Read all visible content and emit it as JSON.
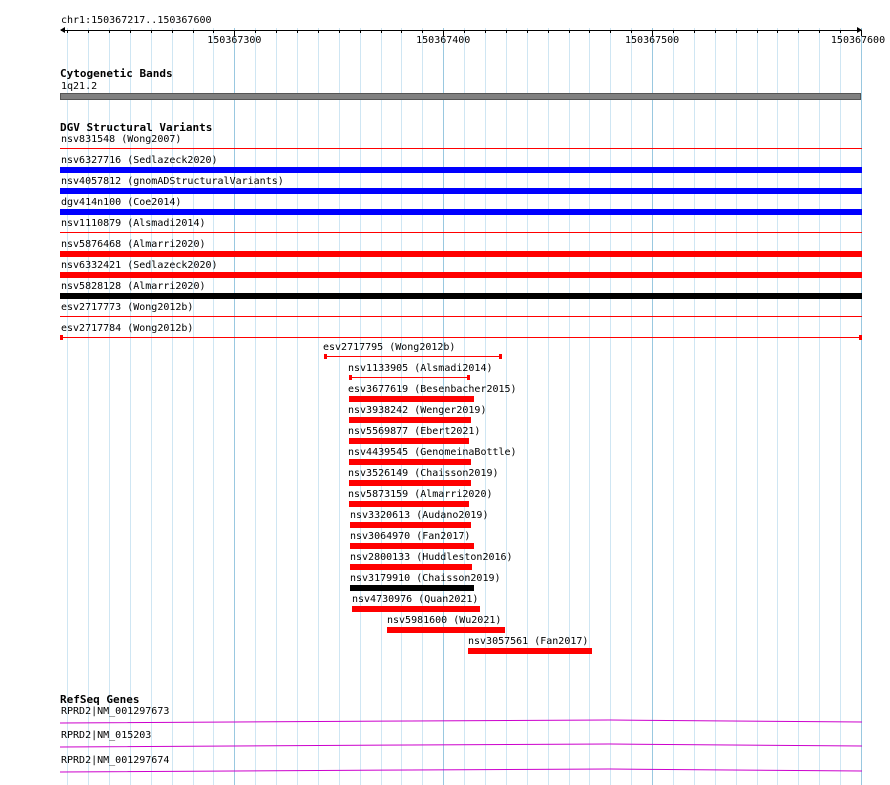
{
  "ruler": {
    "location": "chr1:150367217..150367600",
    "labels": [
      {
        "text": "150367300",
        "pos": 150367300
      },
      {
        "text": "150367400",
        "pos": 150367400
      },
      {
        "text": "150367500",
        "pos": 150367500
      },
      {
        "text": "150367600",
        "pos": 150367600
      }
    ]
  },
  "tracks": {
    "cytobands": {
      "title": "Cytogenetic Bands",
      "band": {
        "name": "1q21.2",
        "color": "#808080"
      }
    },
    "dgv": {
      "title": "DGV Structural Variants",
      "full_width_items": [
        {
          "label": "nsv831548 (Wong2007)",
          "color": "#ff0000",
          "style": "thin-line"
        },
        {
          "label": "nsv6327716 (Sedlazeck2020)",
          "color": "#0000ff",
          "style": "thick"
        },
        {
          "label": "nsv4057812 (gnomADStructuralVariants)",
          "color": "#0000ff",
          "style": "thick"
        },
        {
          "label": "dgv414n100 (Coe2014)",
          "color": "#0000ff",
          "style": "thick"
        },
        {
          "label": "nsv1110879 (Alsmadi2014)",
          "color": "#ff0000",
          "style": "thin-line"
        },
        {
          "label": "nsv5876468 (Almarri2020)",
          "color": "#ff0000",
          "style": "thick"
        },
        {
          "label": "nsv6332421 (Sedlazeck2020)",
          "color": "#ff0000",
          "style": "thick"
        },
        {
          "label": "nsv5828128 (Almarri2020)",
          "color": "#000000",
          "style": "thick"
        },
        {
          "label": "esv2717773 (Wong2012b)",
          "color": "#ff0000",
          "style": "thin-line"
        },
        {
          "label": "esv2717784 (Wong2012b)",
          "color": "#ff0000",
          "style": "thin-capped"
        }
      ],
      "partial_items": [
        {
          "label": "esv2717795 (Wong2012b)",
          "color": "#ff0000",
          "style": "thin-capped"
        },
        {
          "label": "nsv1133905 (Alsmadi2014)",
          "color": "#ff0000",
          "style": "thin-capped"
        },
        {
          "label": "esv3677619 (Besenbacher2015)",
          "color": "#ff0000",
          "style": "thick"
        },
        {
          "label": "nsv3938242 (Wenger2019)",
          "color": "#ff0000",
          "style": "thick"
        },
        {
          "label": "nsv5569877 (Ebert2021)",
          "color": "#ff0000",
          "style": "thick"
        },
        {
          "label": "nsv4439545 (GenomeinaBottle)",
          "color": "#ff0000",
          "style": "thick"
        },
        {
          "label": "nsv3526149 (Chaisson2019)",
          "color": "#ff0000",
          "style": "thick"
        },
        {
          "label": "nsv5873159 (Almarri2020)",
          "color": "#ff0000",
          "style": "thick"
        },
        {
          "label": "nsv3320613 (Audano2019)",
          "color": "#ff0000",
          "style": "thick"
        },
        {
          "label": "nsv3064970 (Fan2017)",
          "color": "#ff0000",
          "style": "thick"
        },
        {
          "label": "nsv2800133 (Huddleston2016)",
          "color": "#ff0000",
          "style": "thick"
        },
        {
          "label": "nsv3179910 (Chaisson2019)",
          "color": "#000000",
          "style": "thick"
        },
        {
          "label": "nsv4730976 (Quan2021)",
          "color": "#ff0000",
          "style": "thick"
        },
        {
          "label": "nsv5981600 (Wu2021)",
          "color": "#ff0000",
          "style": "thick"
        },
        {
          "label": "nsv3057561 (Fan2017)",
          "color": "#ff0000",
          "style": "thick"
        }
      ]
    },
    "refseq": {
      "title": "RefSeq Genes",
      "color": "#cc00cc",
      "items": [
        {
          "label": "RPRD2|NM_001297673"
        },
        {
          "label": "RPRD2|NM_015203"
        },
        {
          "label": "RPRD2|NM_001297674"
        }
      ]
    }
  }
}
